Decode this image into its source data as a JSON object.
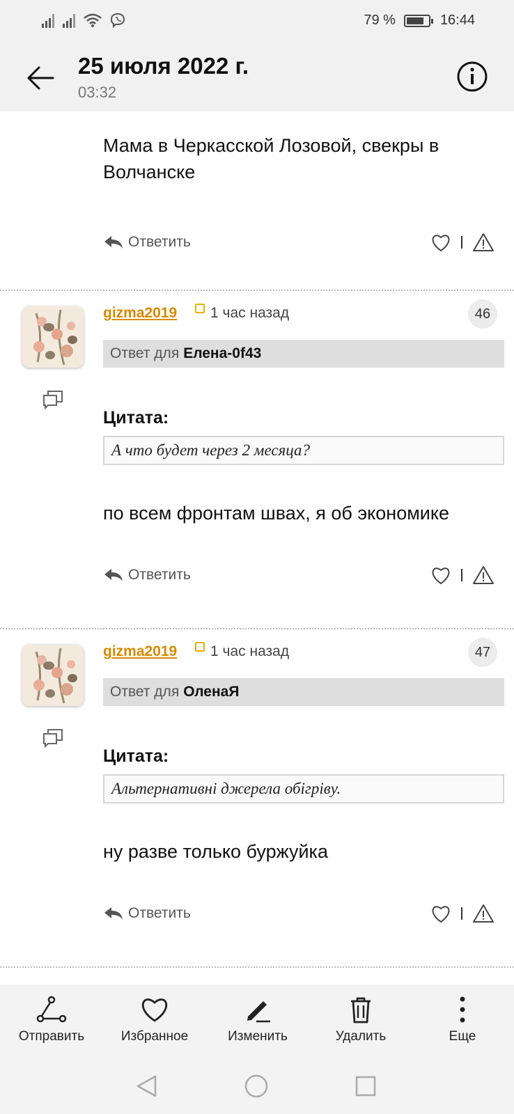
{
  "status_bar": {
    "battery_percent": "79 %",
    "battery_level": 0.79,
    "time": "16:44"
  },
  "header": {
    "title": "25 июля 2022 г.",
    "subtitle": "03:32"
  },
  "first_post": {
    "text_line1": "Мама в Черкасской Лозовой, свекры в",
    "text_line2": "Волчанске",
    "reply_label": "Ответить"
  },
  "comments": [
    {
      "username": "gizma2019",
      "time_ago": "1 час назад",
      "number": "46",
      "reply_prefix": "Ответ для",
      "reply_to": "Елена-0f43",
      "quote_label": "Цитата:",
      "quote_text": "А что будет через 2 месяца?",
      "text": "по всем фронтам швах, я об экономике",
      "reply_label": "Ответить"
    },
    {
      "username": "gizma2019",
      "time_ago": "1 час назад",
      "number": "47",
      "reply_prefix": "Ответ для",
      "reply_to": "ОленаЯ",
      "quote_label": "Цитата:",
      "quote_text": "Альтернативні джерела обігріву.",
      "text": "ну разве только буржуйка",
      "reply_label": "Ответить"
    }
  ],
  "toolbar": {
    "send": "Отправить",
    "favorite": "Избранное",
    "edit": "Изменить",
    "delete": "Удалить",
    "more": "Еще"
  },
  "colors": {
    "username": "#d68a00",
    "bar_background": "#f1f1f1"
  }
}
